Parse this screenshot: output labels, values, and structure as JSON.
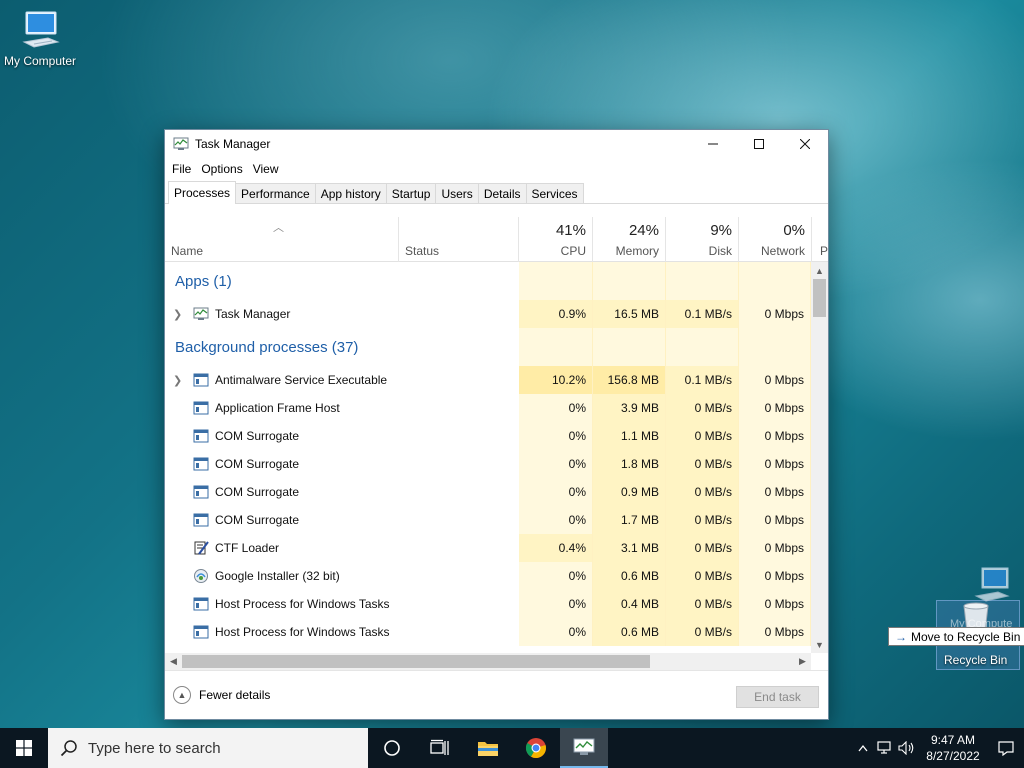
{
  "desktop": {
    "icons": [
      {
        "label": "My Computer"
      },
      {
        "label": "Recycle Bin"
      }
    ],
    "drag_ghost_label": "My Compute",
    "drag_tooltip": "Move to Recycle Bin"
  },
  "window": {
    "title": "Task Manager",
    "menu": [
      "File",
      "Options",
      "View"
    ],
    "tabs": [
      "Processes",
      "Performance",
      "App history",
      "Startup",
      "Users",
      "Details",
      "Services"
    ],
    "active_tab": "Processes",
    "columns": {
      "name": "Name",
      "status": "Status",
      "cpu": {
        "label": "CPU",
        "pct": "41%"
      },
      "memory": {
        "label": "Memory",
        "pct": "24%"
      },
      "disk": {
        "label": "Disk",
        "pct": "9%"
      },
      "network": {
        "label": "Network",
        "pct": "0%"
      },
      "power_partial": "P"
    },
    "groups": {
      "apps": "Apps (1)",
      "background": "Background processes (37)"
    },
    "apps": [
      {
        "name": "Task Manager",
        "cpu": "0.9%",
        "mem": "16.5 MB",
        "disk": "0.1 MB/s",
        "net": "0 Mbps",
        "expandable": true
      }
    ],
    "processes": [
      {
        "name": "Antimalware Service Executable",
        "cpu": "10.2%",
        "mem": "156.8 MB",
        "disk": "0.1 MB/s",
        "net": "0 Mbps",
        "expandable": true
      },
      {
        "name": "Application Frame Host",
        "cpu": "0%",
        "mem": "3.9 MB",
        "disk": "0 MB/s",
        "net": "0 Mbps"
      },
      {
        "name": "COM Surrogate",
        "cpu": "0%",
        "mem": "1.1 MB",
        "disk": "0 MB/s",
        "net": "0 Mbps"
      },
      {
        "name": "COM Surrogate",
        "cpu": "0%",
        "mem": "1.8 MB",
        "disk": "0 MB/s",
        "net": "0 Mbps"
      },
      {
        "name": "COM Surrogate",
        "cpu": "0%",
        "mem": "0.9 MB",
        "disk": "0 MB/s",
        "net": "0 Mbps"
      },
      {
        "name": "COM Surrogate",
        "cpu": "0%",
        "mem": "1.7 MB",
        "disk": "0 MB/s",
        "net": "0 Mbps"
      },
      {
        "name": "CTF Loader",
        "cpu": "0.4%",
        "mem": "3.1 MB",
        "disk": "0 MB/s",
        "net": "0 Mbps"
      },
      {
        "name": "Google Installer (32 bit)",
        "cpu": "0%",
        "mem": "0.6 MB",
        "disk": "0 MB/s",
        "net": "0 Mbps"
      },
      {
        "name": "Host Process for Windows Tasks",
        "cpu": "0%",
        "mem": "0.4 MB",
        "disk": "0 MB/s",
        "net": "0 Mbps"
      },
      {
        "name": "Host Process for Windows Tasks",
        "cpu": "0%",
        "mem": "0.6 MB",
        "disk": "0 MB/s",
        "net": "0 Mbps"
      }
    ],
    "footer": {
      "fewer_details": "Fewer details",
      "end_task": "End task"
    }
  },
  "taskbar": {
    "search_placeholder": "Type here to search",
    "clock_time": "9:47 AM",
    "clock_date": "8/27/2022"
  },
  "colors": {
    "group_label": "#1f5fa8",
    "heat_low": "#fff9de",
    "heat_mid": "#fff4c4",
    "heat_high": "#ffeca6",
    "taskbar": "#0b1721"
  }
}
